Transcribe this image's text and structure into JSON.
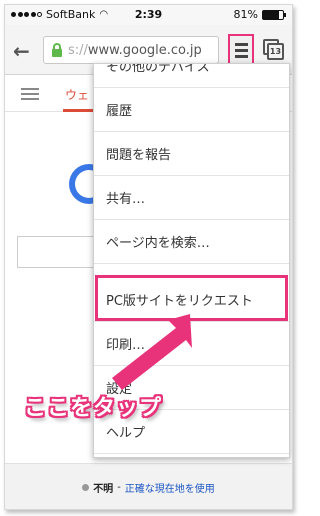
{
  "status_bar": {
    "carrier": "SoftBank",
    "time": "2:39",
    "battery": "81%",
    "battery_level": 0.81
  },
  "toolbar": {
    "url_scheme": "s://",
    "url_host": "www.google.co.jp",
    "tab_count": "13"
  },
  "page": {
    "nav_tab": "ウェ",
    "footer": {
      "location_state": "不明",
      "separator": "-",
      "location_link": "正確な現在地を使用"
    }
  },
  "menu": {
    "items": [
      "その他のデバイス",
      "履歴",
      "問題を報告",
      "共有…",
      "ページ内を検索…",
      "PC版サイトをリクエスト",
      "印刷…",
      "設定",
      "ヘルプ"
    ]
  },
  "annotation": {
    "callout": "ここをタップ",
    "accent_color": "#e8337a"
  }
}
